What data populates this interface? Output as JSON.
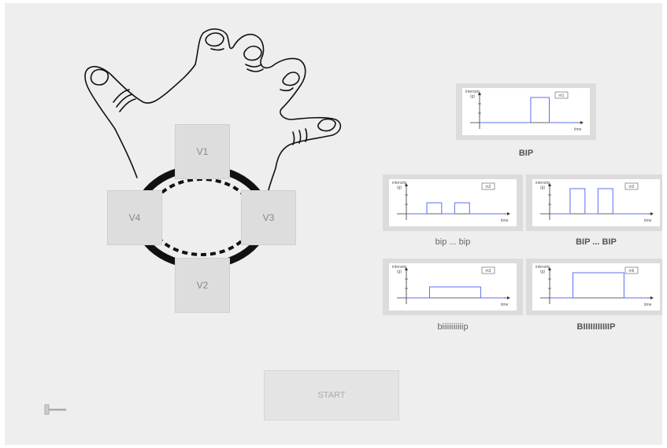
{
  "controls": {
    "vibrators": [
      {
        "id": "v1",
        "label": "V1"
      },
      {
        "id": "v2",
        "label": "V2"
      },
      {
        "id": "v3",
        "label": "V3"
      },
      {
        "id": "v4",
        "label": "V4"
      }
    ],
    "start_label": "START"
  },
  "graph_text": {
    "ylabel_line1": "intensity",
    "ylabel_line2": "(g)",
    "xlabel": "time"
  },
  "patterns": [
    {
      "badge": "m1",
      "caption": "BIP",
      "style": "bold",
      "amplitude": "high",
      "pulses": [
        [
          0.55,
          0.75
        ]
      ]
    },
    {
      "badge": "m2",
      "caption": "bip ... bip",
      "style": "normal",
      "amplitude": "low",
      "pulses": [
        [
          0.22,
          0.38
        ],
        [
          0.52,
          0.68
        ]
      ]
    },
    {
      "badge": "m3",
      "caption": "BIP ... BIP",
      "style": "bold",
      "amplitude": "high",
      "pulses": [
        [
          0.22,
          0.38
        ],
        [
          0.52,
          0.68
        ]
      ]
    },
    {
      "badge": "m3",
      "caption": "biiiiiiiiiiip",
      "style": "normal",
      "amplitude": "low",
      "pulses": [
        [
          0.25,
          0.8
        ]
      ]
    },
    {
      "badge": "m6",
      "caption": "BIIIIIIIIIIIP",
      "style": "bold",
      "amplitude": "high",
      "pulses": [
        [
          0.25,
          0.8
        ]
      ]
    }
  ],
  "colors": {
    "pulse": "#5b6ff0",
    "panel": "#eeeeee",
    "button": "#dddddd"
  }
}
